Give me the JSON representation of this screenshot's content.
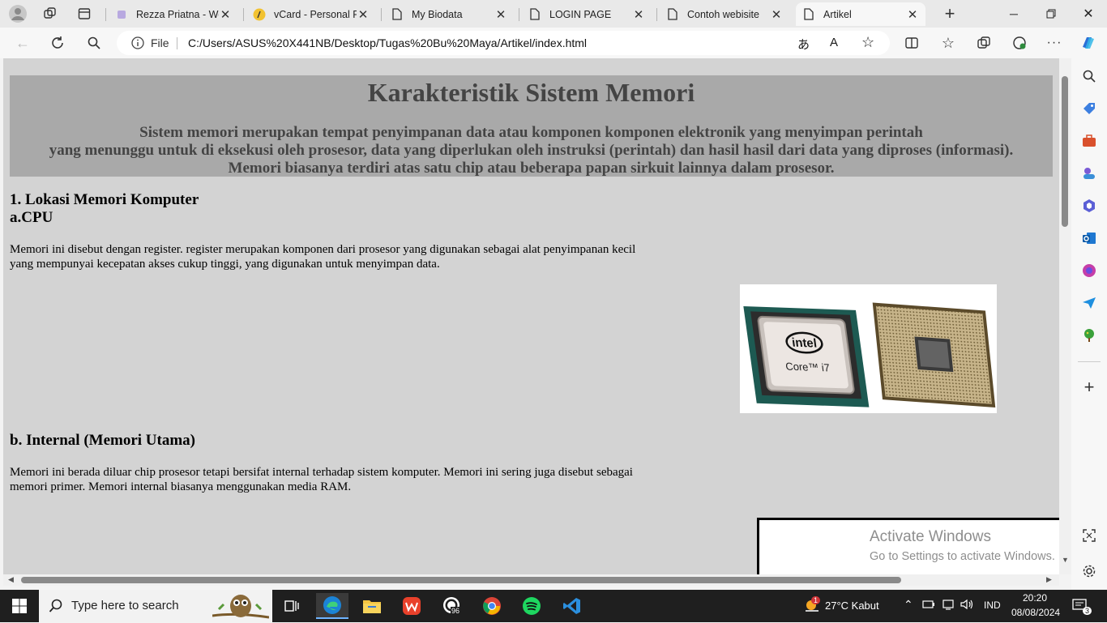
{
  "browser": {
    "tabs": [
      {
        "label": "Rezza Priatna - Web",
        "icon": "profile-tab-icon",
        "active": false
      },
      {
        "label": "vCard - Personal Po",
        "icon": "vcard-tab-icon",
        "active": false
      },
      {
        "label": "My Biodata",
        "icon": "page-icon",
        "active": false
      },
      {
        "label": "LOGIN PAGE",
        "icon": "page-icon",
        "active": false
      },
      {
        "label": "Contoh webisite",
        "icon": "page-icon",
        "active": false
      },
      {
        "label": "Artikel",
        "icon": "page-icon",
        "active": true
      }
    ],
    "address": {
      "file_label": "File",
      "url": "C:/Users/ASUS%20X441NB/Desktop/Tugas%20Bu%20Maya/Artikel/index.html"
    }
  },
  "page": {
    "title": "Karakteristik Sistem Memori",
    "intro_lines": [
      "Sistem memori merupakan tempat penyimpanan data atau komponen komponen elektronik yang menyimpan perintah",
      "yang menunggu untuk di eksekusi oleh prosesor, data yang diperlukan oleh instruksi (perintah) dan hasil hasil dari data yang diproses (informasi).",
      "Memori biasanya terdiri atas satu chip atau beberapa papan sirkuit lainnya dalam prosesor."
    ],
    "section1_heading": "1. Lokasi Memori Komputer",
    "sub_a_heading": "a.CPU",
    "sub_a_text": "Memori ini disebut dengan register. register merupakan komponen dari prosesor yang digunakan sebagai alat penyimpanan kecil yang mempunyai kecepatan akses cukup tinggi, yang digunakan untuk menyimpan data.",
    "cpu_image": {
      "brand": "intel",
      "model_line1": "Core™ i7"
    },
    "sub_b_heading": "b. Internal (Memori Utama)",
    "sub_b_text": "Memori ini berada diluar chip prosesor tetapi bersifat internal terhadap sistem komputer. Memori ini sering juga disebut sebagai memori primer. Memori internal biasanya menggunakan media RAM."
  },
  "watermark": {
    "title": "Activate Windows",
    "subtitle": "Go to Settings to activate Windows."
  },
  "taskbar": {
    "search_placeholder": "Type here to search",
    "whatsapp_badge": "96",
    "weather_badge": "1",
    "weather": "27°C  Kabut",
    "language": "IND",
    "time": "20:20",
    "date": "08/08/2024",
    "notification_count": "3"
  }
}
